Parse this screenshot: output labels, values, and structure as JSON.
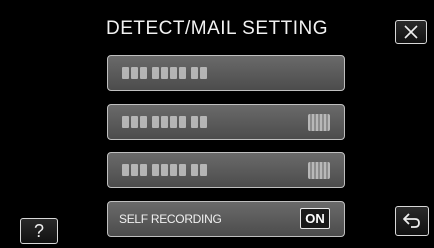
{
  "header": {
    "title": "DETECT/MAIL SETTING"
  },
  "buttons": {
    "help_label": "?",
    "close_icon": "close-icon",
    "back_icon": "back-arrow-icon"
  },
  "menu": {
    "items": [
      {
        "label": "",
        "toggle": ""
      },
      {
        "label": "",
        "toggle": ""
      },
      {
        "label": "",
        "toggle": ""
      },
      {
        "label": "SELF RECORDING",
        "toggle": "ON"
      }
    ]
  },
  "colors": {
    "background": "#000000",
    "item_fill": "#5a5a5a",
    "item_border": "#bfbfbf",
    "text": "#f2f2f2"
  }
}
